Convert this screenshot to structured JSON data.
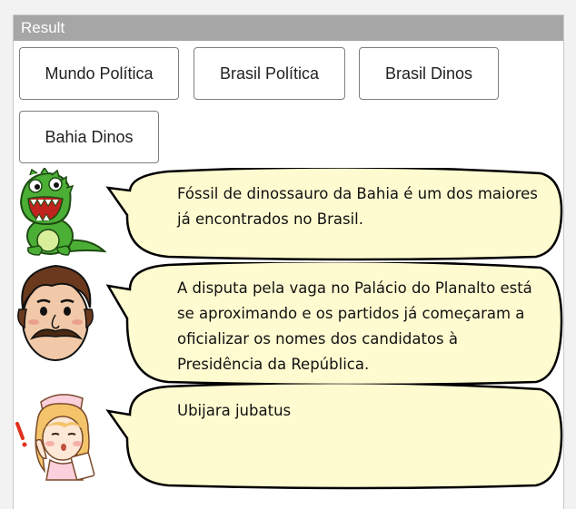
{
  "panel": {
    "title": "Result"
  },
  "buttons": [
    {
      "label": "Mundo Política"
    },
    {
      "label": "Brasil Política"
    },
    {
      "label": "Brasil Dinos"
    },
    {
      "label": "Bahia Dinos"
    }
  ],
  "messages": [
    {
      "avatar": "dinosaur-avatar-icon",
      "text": "Fóssil de dinossauro da Bahia é um dos maiores\njá encontrados no Brasil."
    },
    {
      "avatar": "mustache-man-avatar-icon",
      "text": "A disputa pela vaga no Palácio do Planalto está\nse aproximando e os partidos já começaram a\noficializar os nomes dos candidatos à\nPresidência da República."
    },
    {
      "avatar": "nurse-avatar-icon",
      "text": "Ubijara jubatus"
    }
  ],
  "colors": {
    "header": "#a6a6a6",
    "bubble_fill": "#fffbd0",
    "bubble_stroke": "#000000"
  }
}
